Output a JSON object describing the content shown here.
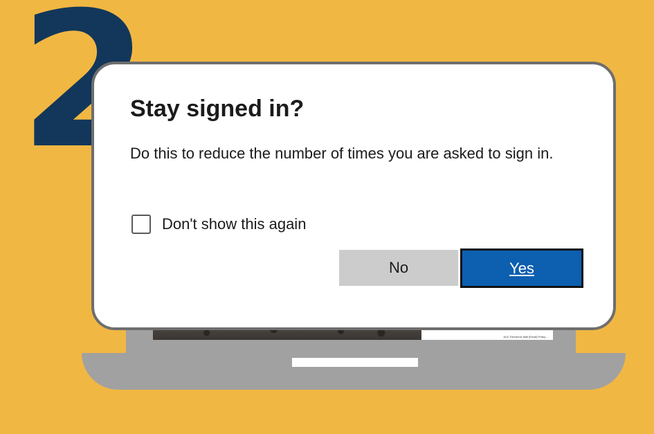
{
  "step": {
    "number": "2"
  },
  "dialog": {
    "title": "Stay signed in?",
    "description": "Do this to reduce the number of times you are asked to sign in.",
    "checkbox": {
      "label": "Don't show this again",
      "checked": false
    },
    "buttons": {
      "no_label": "No",
      "yes_label": "Yes"
    }
  },
  "laptop_screen": {
    "doc_caption": "AUC Electronic Mail (Email) Policy ..."
  },
  "colors": {
    "background": "#F1B743",
    "step_number": "#12375A",
    "primary_button": "#0D5FB0",
    "secondary_button": "#CCCCCC",
    "laptop": "#A1A1A1"
  }
}
